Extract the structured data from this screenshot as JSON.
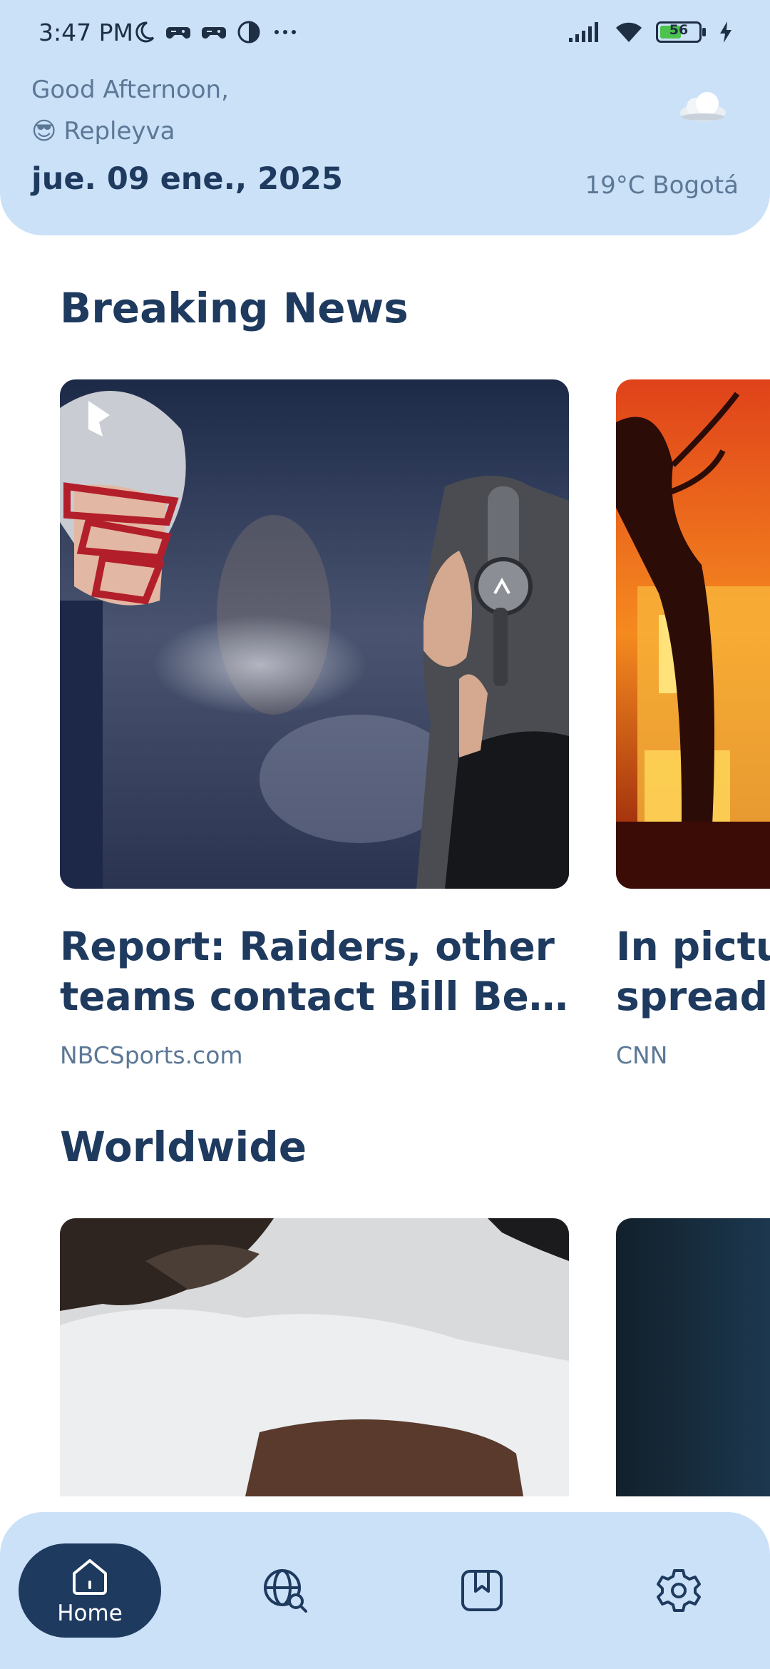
{
  "status": {
    "time": "3:47 PM",
    "battery": "56",
    "battery_level": 0.56
  },
  "header": {
    "greeting": "Good Afternoon,",
    "user_emoji": "😎",
    "user_name": "Repleyva",
    "date": "jue. 09 ene., 2025",
    "weather": "19°C Bogotá",
    "weather_icon": "cloud-icon"
  },
  "sections": {
    "breaking": {
      "title": "Breaking News",
      "cards": [
        {
          "title_line1": "Report: Raiders, other",
          "title_line2": "teams contact Bill Bel…",
          "source": "NBCSports.com"
        },
        {
          "title_line1": "In pictu",
          "title_line2": "spread",
          "source": "CNN"
        }
      ]
    },
    "worldwide": {
      "title": "Worldwide"
    }
  },
  "nav": {
    "home_label": "Home",
    "items": [
      "home-icon",
      "globe-search-icon",
      "bookmark-icon",
      "gear-icon"
    ]
  },
  "colors": {
    "header_bg": "#cbe1f8",
    "primary": "#1e3a5f",
    "muted": "#5c7896"
  }
}
